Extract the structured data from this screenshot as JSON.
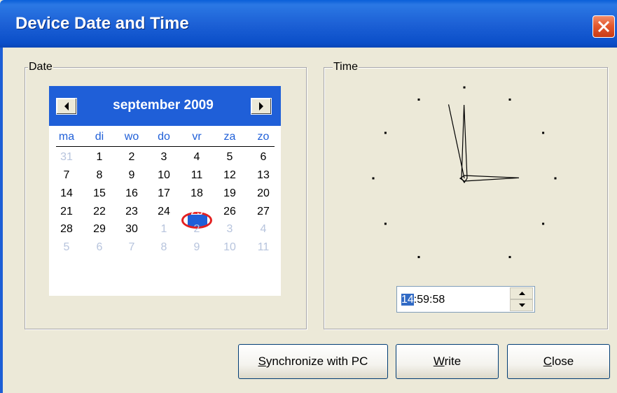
{
  "window": {
    "title": "Device Date and Time"
  },
  "date_group": {
    "label": "Date"
  },
  "time_group": {
    "label": "Time"
  },
  "calendar": {
    "month_title": "september 2009",
    "weekdays": [
      "ma",
      "di",
      "wo",
      "do",
      "vr",
      "za",
      "zo"
    ],
    "weeks": [
      [
        "31",
        "1",
        "2",
        "3",
        "4",
        "5",
        "6"
      ],
      [
        "7",
        "8",
        "9",
        "10",
        "11",
        "12",
        "13"
      ],
      [
        "14",
        "15",
        "16",
        "17",
        "18",
        "19",
        "20"
      ],
      [
        "21",
        "22",
        "23",
        "24",
        "25",
        "26",
        "27"
      ],
      [
        "28",
        "29",
        "30",
        "1",
        "2",
        "3",
        "4"
      ],
      [
        "5",
        "6",
        "7",
        "8",
        "9",
        "10",
        "11"
      ]
    ],
    "selected_day": "25"
  },
  "clock": {
    "hours": 14,
    "minutes": 59,
    "seconds": 58
  },
  "time_field": {
    "hour": "14",
    "rest": ":59:58"
  },
  "buttons": {
    "sync_prefix": "",
    "sync_underline": "S",
    "sync_rest": "ynchronize with PC",
    "write_underline": "W",
    "write_rest": "rite",
    "close_underline": "C",
    "close_rest": "lose"
  },
  "colors": {
    "titlebar": "#1d61d6",
    "calendar_header": "#1f5fd8",
    "weekday_text": "#1f5fd8",
    "today_ring": "#e32020",
    "muted_day": "#b7c4dd"
  }
}
